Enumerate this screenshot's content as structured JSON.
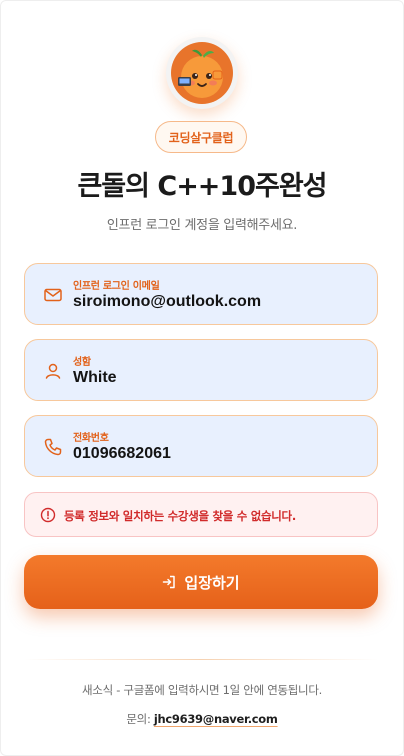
{
  "header": {
    "badge": "코딩살구클럽",
    "title": "큰돌의 C++10주완성",
    "subtitle": "인프런 로그인 계정을 입력해주세요."
  },
  "form": {
    "email": {
      "label": "인프런 로그인 이메일",
      "value": "siroimono@outlook.com",
      "icon": "mail-icon"
    },
    "name": {
      "label": "성함",
      "value": "White",
      "icon": "user-icon"
    },
    "phone": {
      "label": "전화번호",
      "value": "01096682061",
      "icon": "phone-icon"
    }
  },
  "error": {
    "message": "등록 정보와 일치하는 수강생을 찾을 수 없습니다.",
    "icon": "alert-circle-icon"
  },
  "submit": {
    "label": "입장하기",
    "icon": "enter-icon"
  },
  "footer": {
    "notice": "새소식 - 구글폼에 입력하시면 1일 안에 연동됩니다.",
    "contact_prefix": "문의:",
    "contact_email": "jhc9639@naver.com"
  },
  "colors": {
    "accent": "#e5611a",
    "field_bg": "#e8f0fe",
    "field_border": "#f7c89c",
    "error_bg": "#fff1f1",
    "error_text": "#d12b2b"
  }
}
